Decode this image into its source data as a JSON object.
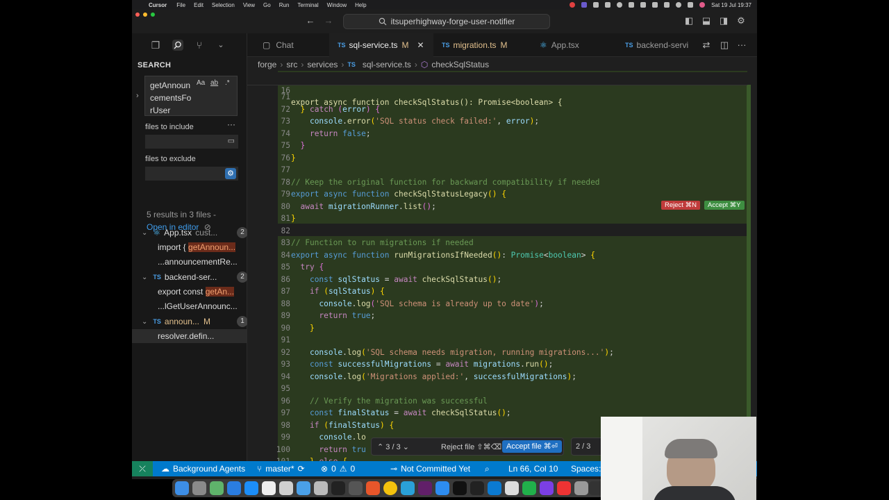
{
  "menubar": {
    "app": "Cursor",
    "items": [
      "File",
      "Edit",
      "Selection",
      "View",
      "Go",
      "Run",
      "Terminal",
      "Window",
      "Help"
    ],
    "clock": "Sat 19 Jul 19:37"
  },
  "titlebar": {
    "project": "itsuperhighway-forge-user-notifier"
  },
  "sidebar": {
    "title": "SEARCH",
    "query": "getAnnouncementsForUser",
    "options": {
      "match_case": "Aa",
      "whole_word": "ab",
      "regex": ".*"
    },
    "include_label": "files to include",
    "exclude_label": "files to exclude",
    "summary": "5 results in 3 files -",
    "open_in_editor": "Open in editor",
    "files": [
      {
        "name": "App.tsx",
        "suffix": "cust...",
        "count": "2",
        "matches": [
          {
            "pre": "import { ",
            "hit": "getAnnoun..."
          },
          {
            "pre": "...announcementRe...",
            "hit": ""
          }
        ]
      },
      {
        "name": "backend-ser...",
        "suffix": "",
        "count": "2",
        "matches": [
          {
            "pre": "export const ",
            "hit": "getAn..."
          },
          {
            "pre": "...lGetUserAnnounc...",
            "hit": ""
          }
        ]
      },
      {
        "name": "announ...",
        "suffix": "M",
        "count": "1",
        "matches": [
          {
            "pre": "resolver.defin...",
            "hit": ""
          }
        ]
      }
    ]
  },
  "tabs": [
    {
      "label": "Chat",
      "mark": ""
    },
    {
      "label": "sql-service.ts",
      "mark": "M"
    },
    {
      "label": "migration.ts",
      "mark": "M"
    },
    {
      "label": "App.tsx",
      "mark": ""
    },
    {
      "label": "backend-servi",
      "mark": ""
    }
  ],
  "breadcrumb": [
    "forge",
    "src",
    "services",
    "sql-service.ts",
    "checkSqlStatus"
  ],
  "sticky": {
    "num": "16",
    "code": "export async function checkSqlStatus(): Promise<boolean> {"
  },
  "inline_actions": {
    "reject": "Reject ⌘N",
    "accept": "Accept ⌘Y"
  },
  "review_bar": {
    "counter": "3 / 3",
    "reject_file": "Reject file ⇧⌘⌫",
    "accept_file": "Accept file ⌘⏎",
    "pager": "2 / 3"
  },
  "statusbar": {
    "agents": "Background Agents",
    "branch": "master*",
    "problems_errors": "0",
    "problems_warnings": "0",
    "commit": "Not Committed Yet",
    "cursor": "Ln 66, Col 10",
    "spaces": "Spaces:"
  },
  "colors": {
    "accent": "#007acc",
    "added": "#2b3a1f",
    "reject": "#c03b3b",
    "accept": "#3e8e41",
    "link": "#3f9ceb"
  }
}
